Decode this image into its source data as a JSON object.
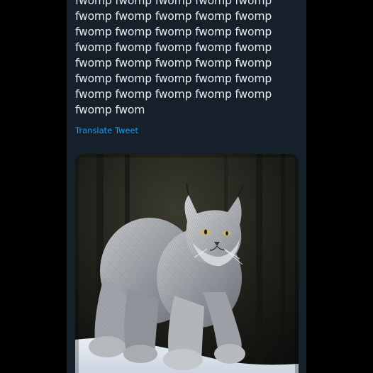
{
  "tweet": {
    "text": "fwomp fwomp fwomp fwomp fwomp\nfwomp fwomp fwomp fwomp fwomp\nfwomp fwomp fwomp fwomp fwomp\nfwomp fwomp fwomp fwomp fwomp\nfwomp fwomp fwomp fwomp fwomp\nfwomp fwomp fwomp fwomp fwomp\nfwomp fwomp fwomp fwomp fwomp\nfwomp fwom",
    "translate_label": "Translate Tweet"
  },
  "colors": {
    "page_background": "#000000",
    "card_background": "#15202b",
    "text": "#e7e9ea",
    "link": "#1d9bf0"
  }
}
